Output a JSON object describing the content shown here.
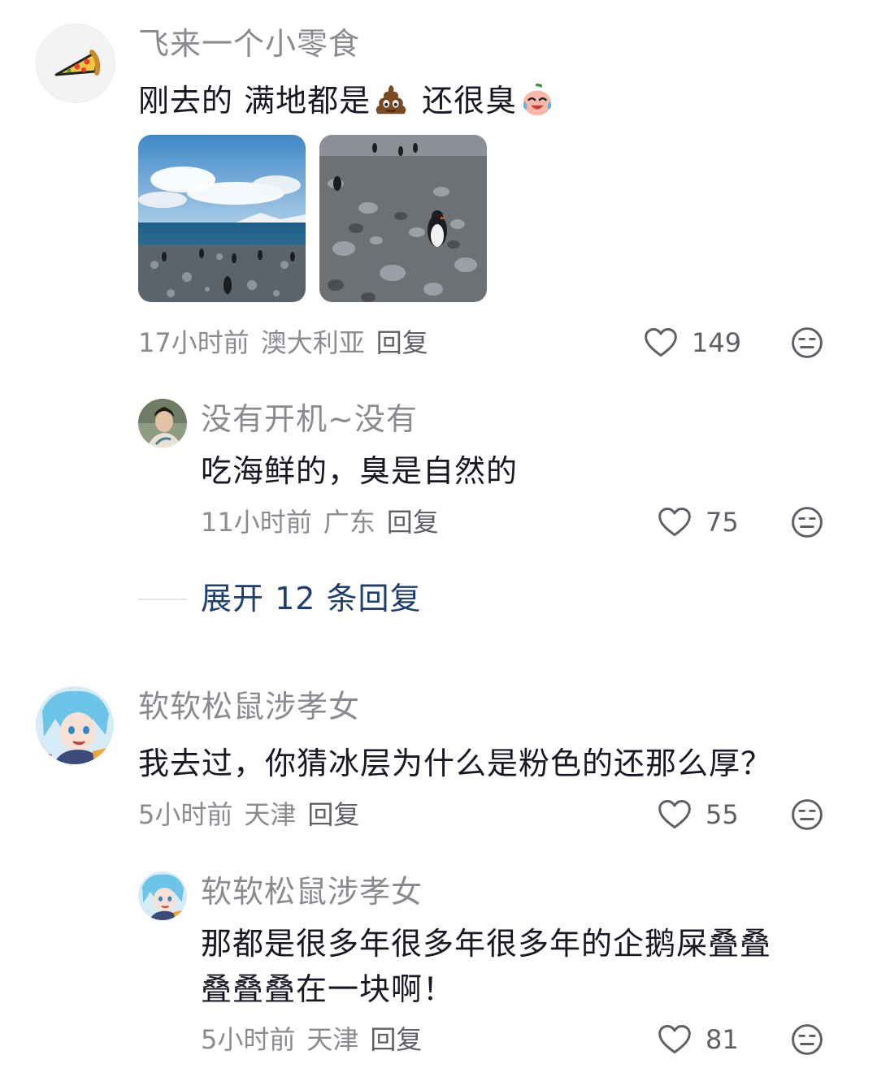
{
  "comments": [
    {
      "username": "飞来一个小零食",
      "text_before": "刚去的 满地都是",
      "emoji1": "poop-emoji",
      "text_middle": " 还很臭",
      "emoji2": "crying-laughing-emoji",
      "images": [
        "penguins-beach-photo",
        "penguin-rocks-photo"
      ],
      "time": "17小时前",
      "location": "澳大利亚",
      "reply_label": "回复",
      "likes": "149",
      "avatar_icon": "pizza-icon",
      "replies": [
        {
          "username": "没有开机~没有",
          "text": "吃海鲜的，臭是自然的",
          "time": "11小时前",
          "location": "广东",
          "reply_label": "回复",
          "likes": "75"
        }
      ],
      "expand_label": "展开 12 条回复"
    },
    {
      "username": "软软松鼠涉孝女",
      "text": "我去过，你猜冰层为什么是粉色的还那么厚？",
      "time": "5小时前",
      "location": "天津",
      "reply_label": "回复",
      "likes": "55",
      "replies": [
        {
          "username": "软软松鼠涉孝女",
          "text_line1": "那都是很多年很多年很多年的企鹅屎叠叠",
          "text_line2": "叠叠叠在一块啊！",
          "time": "5小时前",
          "location": "天津",
          "reply_label": "回复",
          "likes": "81"
        }
      ]
    }
  ],
  "colors": {
    "username": "#8a8b91",
    "text": "#161823",
    "expand": "#1d3e6e",
    "icon": "#5e5f66"
  }
}
